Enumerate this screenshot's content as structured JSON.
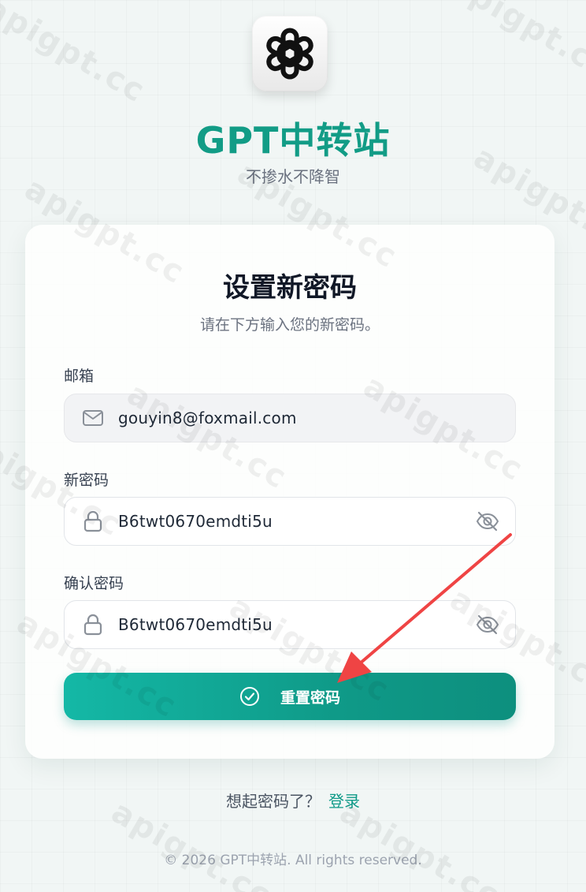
{
  "brand": {
    "title": "GPT中转站",
    "subtitle": "不掺水不降智",
    "logo_icon": "openai-logo-icon"
  },
  "form": {
    "title": "设置新密码",
    "subtitle": "请在下方输入您的新密码。",
    "email": {
      "label": "邮箱",
      "value": "gouyin8@foxmail.com",
      "icon": "mail-icon"
    },
    "new_password": {
      "label": "新密码",
      "value": "B6twt0670emdti5u",
      "icon": "lock-icon",
      "toggle_icon": "eye-off-icon"
    },
    "confirm_password": {
      "label": "确认密码",
      "value": "B6twt0670emdti5u",
      "icon": "lock-icon",
      "toggle_icon": "eye-off-icon"
    },
    "submit_label": "重置密码",
    "submit_icon": "check-circle-icon"
  },
  "login_prompt": {
    "text": "想起密码了？",
    "link_label": "登录"
  },
  "footer": {
    "copyright": "© 2026 GPT中转站. All rights reserved."
  },
  "watermark": {
    "text": "apigpt.cc"
  },
  "colors": {
    "accent": "#129c86",
    "button_start": "#14b8a6",
    "button_end": "#0d8f7e",
    "annotation_arrow": "#ef4444"
  }
}
